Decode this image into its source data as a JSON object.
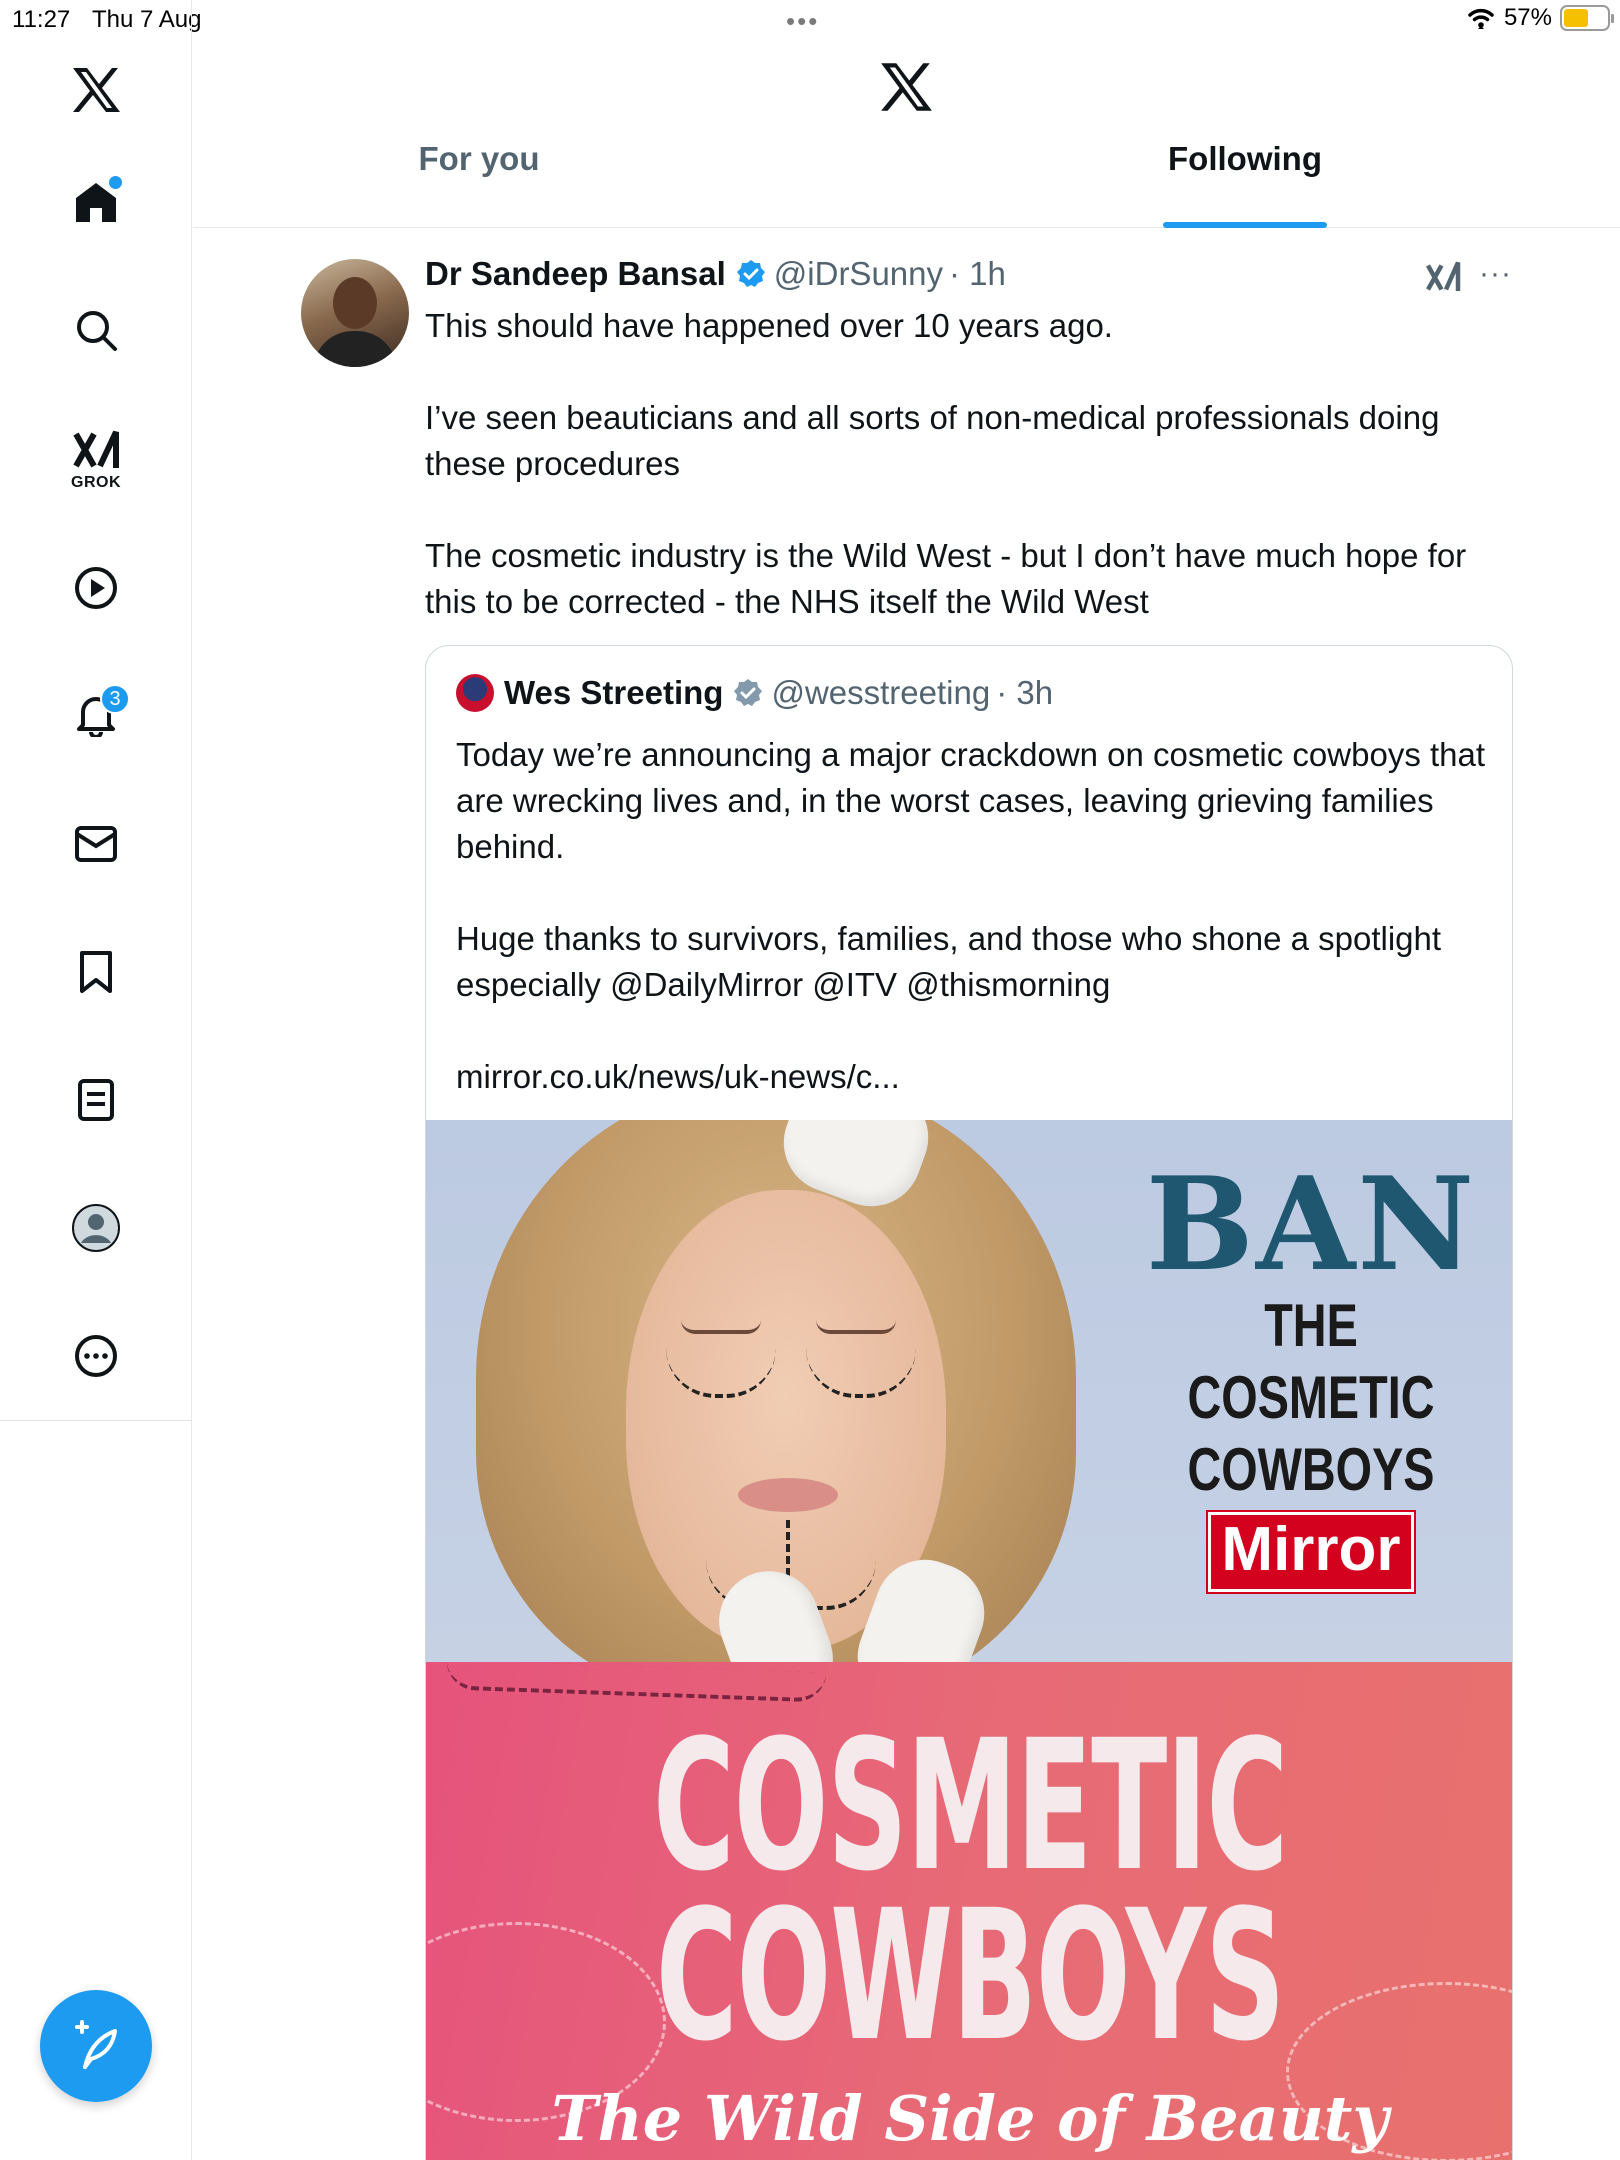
{
  "status_bar": {
    "time": "11:27",
    "date": "Thu 7 Aug",
    "battery": "57%",
    "battery_level": 0.57
  },
  "sidebar": {
    "items": [
      {
        "name": "x-logo",
        "icon": "x-logo-icon"
      },
      {
        "name": "home",
        "icon": "home-icon",
        "has_dot": true
      },
      {
        "name": "search",
        "icon": "search-icon"
      },
      {
        "name": "grok",
        "icon": "grok-icon",
        "label": "GROK"
      },
      {
        "name": "video",
        "icon": "play-icon"
      },
      {
        "name": "notifications",
        "icon": "bell-icon",
        "badge": "3"
      },
      {
        "name": "messages",
        "icon": "mail-icon"
      },
      {
        "name": "bookmarks",
        "icon": "bookmark-icon"
      },
      {
        "name": "lists",
        "icon": "list-icon"
      },
      {
        "name": "profile",
        "icon": "avatar-icon"
      },
      {
        "name": "more",
        "icon": "more-circle-icon"
      }
    ],
    "compose_icon": "compose-feather-icon"
  },
  "header": {
    "tabs": [
      {
        "label": "For you",
        "active": false
      },
      {
        "label": "Following",
        "active": true
      }
    ]
  },
  "tweet": {
    "author_name": "Dr Sandeep Bansal",
    "handle": "@iDrSunny",
    "time": "· 1h",
    "paragraphs": [
      "This should have happened over 10 years ago.",
      "I’ve seen beauticians and all sorts of non-medical professionals doing these procedures",
      "The cosmetic industry is the Wild West - but I don’t have much hope for this to be corrected - the NHS itself the Wild West"
    ],
    "more_label": "···",
    "quoted": {
      "author_name": "Wes Streeting",
      "handle": "@wesstreeting",
      "time": "· 3h",
      "paragraphs": [
        "Today we’re announcing a major crackdown on cosmetic cowboys that are wrecking lives and, in the worst cases, leaving grieving families behind.",
        "Huge thanks to survivors, families, and those who shone a spotlight especially @DailyMirror @ITV @thismorning",
        "mirror.co.uk/news/uk-news/c..."
      ],
      "media": {
        "top": {
          "headline": "BAN",
          "line1": "THE",
          "line2": "COSMETIC",
          "line3": "COWBOYS",
          "brand": "Mirror"
        },
        "bottom": {
          "line1": "COSMETIC",
          "line2": "COWBOYS",
          "subtitle": "The Wild Side of Beauty"
        }
      }
    }
  },
  "colors": {
    "accent": "#1d9bf0",
    "text": "#0f1419",
    "muted": "#536471",
    "mirror_red": "#d3001e",
    "ban_blue": "#1f5770"
  }
}
